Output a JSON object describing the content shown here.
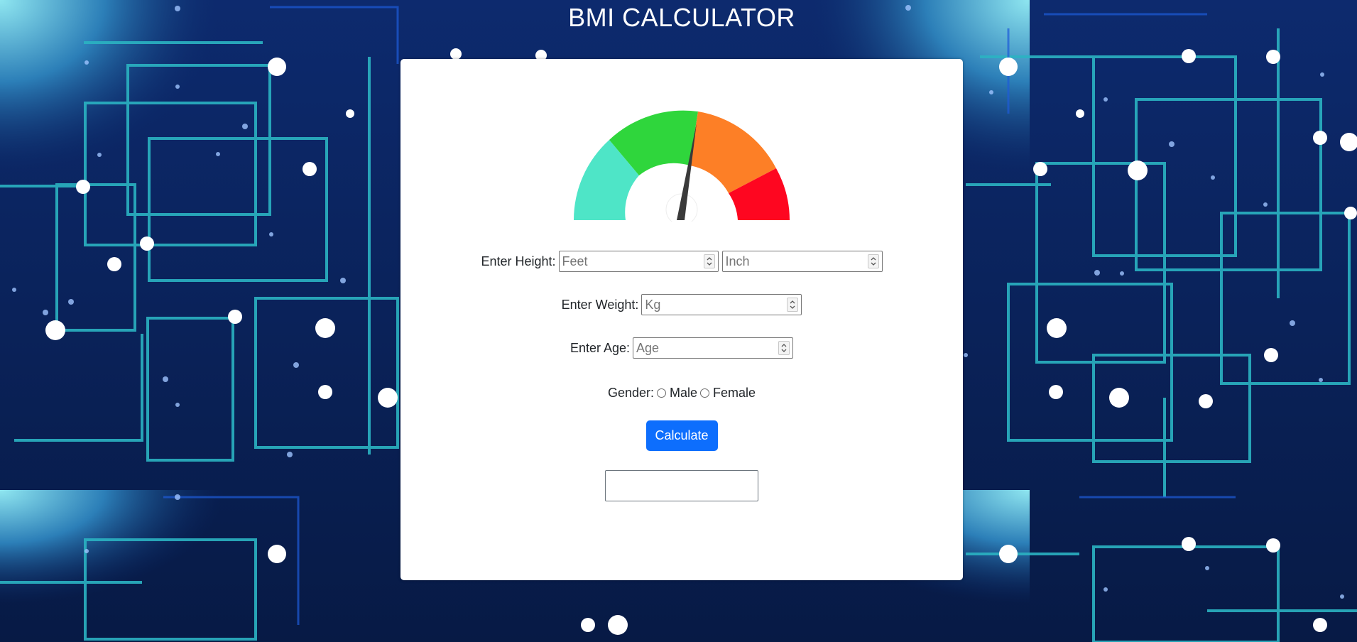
{
  "app": {
    "title": "BMI CALCULATOR"
  },
  "gauge": {
    "colors": [
      "#4ee5c7",
      "#2fd63c",
      "#fd7f26",
      "#fe0620"
    ],
    "needle_color": "#3a3a3a"
  },
  "form": {
    "height": {
      "label": "Enter Height:",
      "feet_placeholder": "Feet",
      "inch_placeholder": "Inch"
    },
    "weight": {
      "label": "Enter Weight:",
      "placeholder": "Kg"
    },
    "age": {
      "label": "Enter Age:",
      "placeholder": "Age"
    },
    "gender": {
      "label": "Gender:",
      "options": [
        "Male",
        "Female"
      ]
    },
    "calculate_label": "Calculate",
    "result": ""
  },
  "colors": {
    "accent": "#0d6efd",
    "card": "#ffffff",
    "background": "#0a1f4f"
  },
  "icons": {
    "spinner": "spin-arrows-icon",
    "needle": "gauge-needle-icon"
  }
}
